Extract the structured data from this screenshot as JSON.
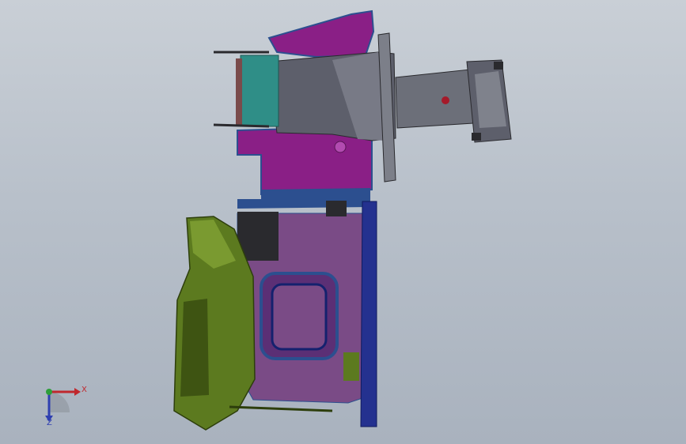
{
  "viewport": {
    "background_top": "#c9cfd6",
    "background_bottom": "#a9b2be"
  },
  "model": {
    "part_colors": {
      "housing_magenta": "#8a1f86",
      "housing_purple": "#7a4b86",
      "duct_gray": "#5d5f6b",
      "outlet_gray": "#6c6f79",
      "filter_teal": "#2f8e87",
      "bracket_navy": "#24318f",
      "blower_green": "#5c7a1f",
      "motor_black": "#2a2a2e",
      "edge_blue": "#2c4f8f"
    }
  },
  "triad": {
    "x_label": "X",
    "z_label": "Z",
    "x_color": "#c0282d",
    "y_color": "#2e9e3a",
    "z_color": "#2f3fb0"
  }
}
